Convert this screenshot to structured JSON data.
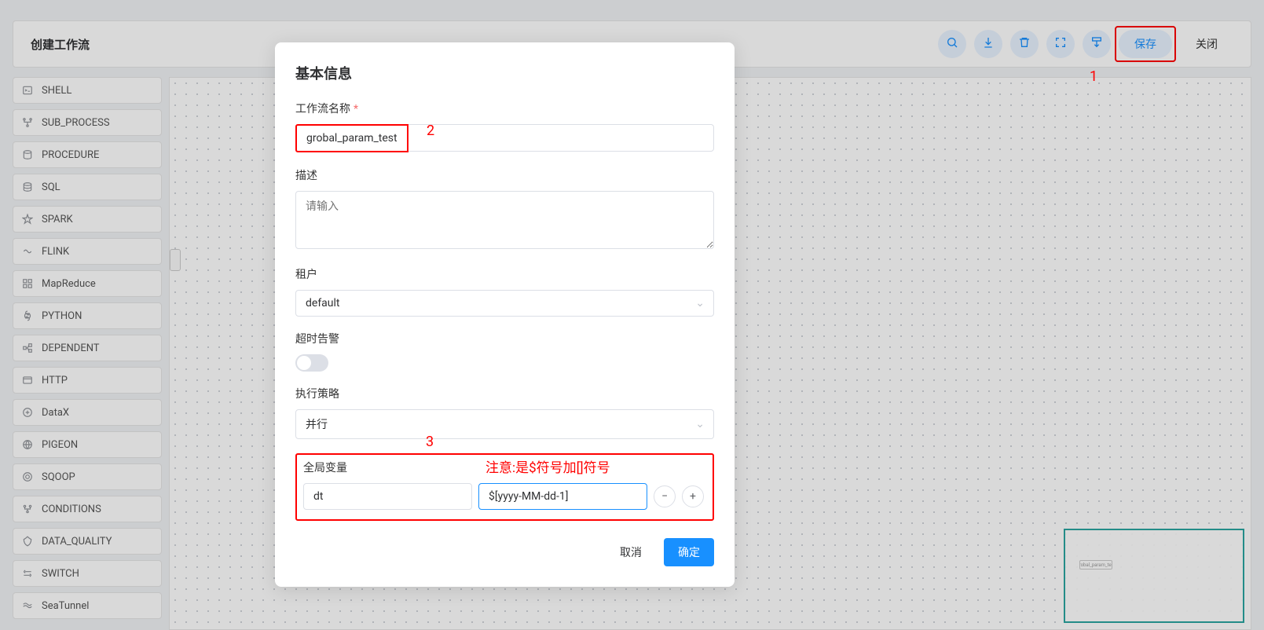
{
  "topbar": {
    "title": "创建工作流",
    "save_label": "保存",
    "close_label": "关闭"
  },
  "sidebar": {
    "items": [
      {
        "label": "SHELL"
      },
      {
        "label": "SUB_PROCESS"
      },
      {
        "label": "PROCEDURE"
      },
      {
        "label": "SQL"
      },
      {
        "label": "SPARK"
      },
      {
        "label": "FLINK"
      },
      {
        "label": "MapReduce"
      },
      {
        "label": "PYTHON"
      },
      {
        "label": "DEPENDENT"
      },
      {
        "label": "HTTP"
      },
      {
        "label": "DataX"
      },
      {
        "label": "PIGEON"
      },
      {
        "label": "SQOOP"
      },
      {
        "label": "CONDITIONS"
      },
      {
        "label": "DATA_QUALITY"
      },
      {
        "label": "SWITCH"
      },
      {
        "label": "SeaTunnel"
      }
    ]
  },
  "modal": {
    "title": "基本信息",
    "name_label": "工作流名称",
    "name_value": "grobal_param_test",
    "desc_label": "描述",
    "desc_placeholder": "请输入",
    "tenant_label": "租户",
    "tenant_value": "default",
    "timeout_label": "超时告警",
    "strategy_label": "执行策略",
    "strategy_value": "并行",
    "global_label": "全局变量",
    "global_key": "dt",
    "global_val": "$[yyyy-MM-dd-1]",
    "cancel_label": "取消",
    "confirm_label": "确定"
  },
  "annotations": {
    "num1": "1",
    "num2": "2",
    "num3": "3",
    "note": "注意:是$符号加[]符号"
  },
  "minimap": {
    "chip": "grobal_param_test"
  }
}
